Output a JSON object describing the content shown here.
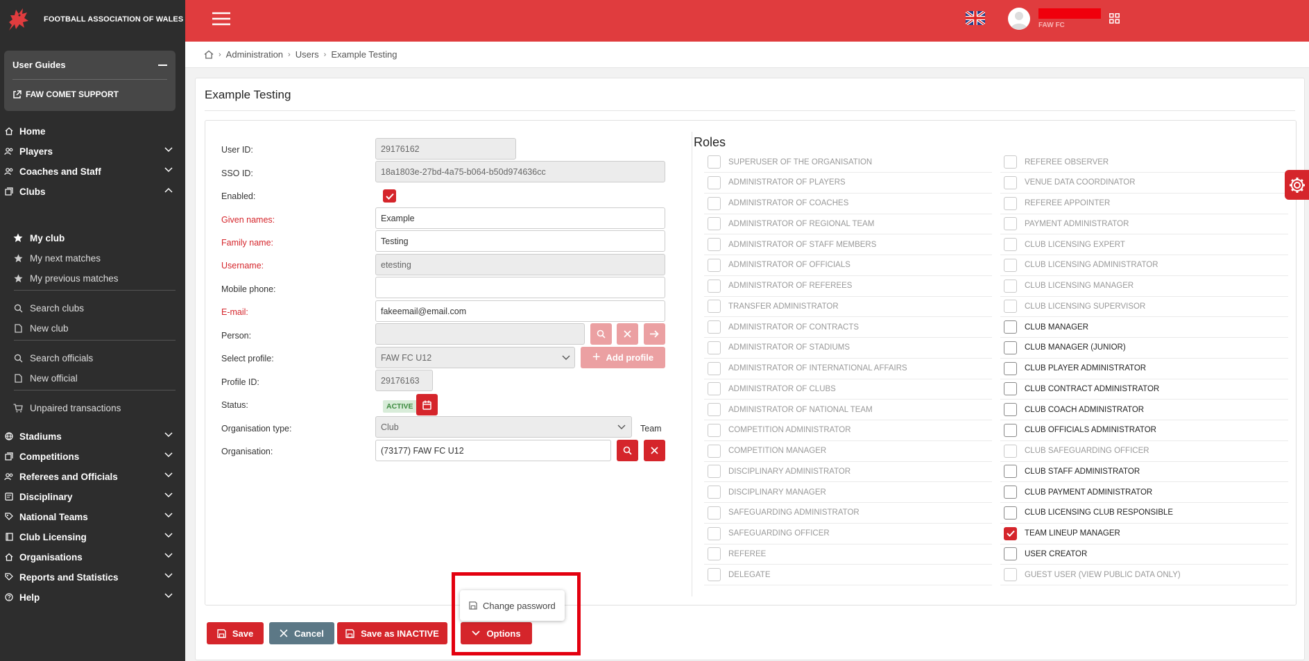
{
  "brand": {
    "name": "FOOTBALL ASSOCIATION OF WALES"
  },
  "sidebar": {
    "guides_title": "User Guides",
    "support_link": "FAW COMET SUPPORT",
    "nav": [
      {
        "label": "Home",
        "icon": "home-icon"
      },
      {
        "label": "Players",
        "icon": "players-icon"
      },
      {
        "label": "Coaches and Staff",
        "icon": "coaches-icon"
      },
      {
        "label": "Clubs",
        "icon": "clubs-icon"
      },
      {
        "label": "Stadiums",
        "icon": "stadium-icon"
      },
      {
        "label": "Competitions",
        "icon": "competitions-icon"
      },
      {
        "label": "Referees and Officials",
        "icon": "referees-icon"
      },
      {
        "label": "Disciplinary",
        "icon": "disciplinary-icon"
      },
      {
        "label": "National Teams",
        "icon": "national-teams-icon"
      },
      {
        "label": "Club Licensing",
        "icon": "club-licensing-icon"
      },
      {
        "label": "Organisations",
        "icon": "organisations-icon"
      },
      {
        "label": "Reports and Statistics",
        "icon": "reports-icon"
      },
      {
        "label": "Help",
        "icon": "help-icon"
      }
    ],
    "clubs_sub": [
      {
        "label": "My club",
        "icon": "star-icon"
      },
      {
        "label": "My next matches",
        "icon": "star-icon"
      },
      {
        "label": "My previous matches",
        "icon": "star-icon"
      },
      {
        "label": "Search clubs",
        "icon": "search-icon"
      },
      {
        "label": "New club",
        "icon": "document-icon"
      },
      {
        "label": "Search officials",
        "icon": "search-icon"
      },
      {
        "label": "New official",
        "icon": "document-icon"
      },
      {
        "label": "Unpaired transactions",
        "icon": "cart-icon"
      }
    ]
  },
  "header": {
    "user_club": "FAW FC"
  },
  "breadcrumb": [
    "Administration",
    "Users",
    "Example Testing"
  ],
  "page": {
    "title": "Example Testing"
  },
  "form": {
    "user_id_label": "User ID:",
    "user_id": "29176162",
    "sso_id_label": "SSO ID:",
    "sso_id": "18a1803e-27bd-4a75-b064-b50d974636cc",
    "enabled_label": "Enabled:",
    "given_names_label": "Given names:",
    "given_names": "Example",
    "family_name_label": "Family name:",
    "family_name": "Testing",
    "username_label": "Username:",
    "username": "etesting",
    "mobile_label": "Mobile phone:",
    "mobile": "",
    "email_label": "E-mail:",
    "email": "fakeemail@email.com",
    "person_label": "Person:",
    "person": "",
    "profile_label": "Select profile:",
    "profile": "FAW FC U12",
    "add_profile": "Add profile",
    "profile_id_label": "Profile ID:",
    "profile_id": "29176163",
    "status_label": "Status:",
    "status": "ACTIVE",
    "org_type_label": "Organisation type:",
    "org_type": "Club",
    "org_type_extra": "Team",
    "org_label": "Organisation:",
    "org": "(73177) FAW FC U12"
  },
  "roles": {
    "title": "Roles",
    "left": [
      {
        "label": "SUPERUSER OF THE ORGANISATION",
        "enabled": false,
        "checked": false
      },
      {
        "label": "ADMINISTRATOR OF PLAYERS",
        "enabled": false,
        "checked": false
      },
      {
        "label": "ADMINISTRATOR OF COACHES",
        "enabled": false,
        "checked": false
      },
      {
        "label": "ADMINISTRATOR OF REGIONAL TEAM",
        "enabled": false,
        "checked": false
      },
      {
        "label": "ADMINISTRATOR OF STAFF MEMBERS",
        "enabled": false,
        "checked": false
      },
      {
        "label": "ADMINISTRATOR OF OFFICIALS",
        "enabled": false,
        "checked": false
      },
      {
        "label": "ADMINISTRATOR OF REFEREES",
        "enabled": false,
        "checked": false
      },
      {
        "label": "TRANSFER ADMINISTRATOR",
        "enabled": false,
        "checked": false
      },
      {
        "label": "ADMINISTRATOR OF CONTRACTS",
        "enabled": false,
        "checked": false
      },
      {
        "label": "ADMINISTRATOR OF STADIUMS",
        "enabled": false,
        "checked": false
      },
      {
        "label": "ADMINISTRATOR OF INTERNATIONAL AFFAIRS",
        "enabled": false,
        "checked": false
      },
      {
        "label": "ADMINISTRATOR OF CLUBS",
        "enabled": false,
        "checked": false
      },
      {
        "label": "ADMINISTRATOR OF NATIONAL TEAM",
        "enabled": false,
        "checked": false
      },
      {
        "label": "COMPETITION ADMINISTRATOR",
        "enabled": false,
        "checked": false
      },
      {
        "label": "COMPETITION MANAGER",
        "enabled": false,
        "checked": false
      },
      {
        "label": "DISCIPLINARY ADMINISTRATOR",
        "enabled": false,
        "checked": false
      },
      {
        "label": "DISCIPLINARY MANAGER",
        "enabled": false,
        "checked": false
      },
      {
        "label": "SAFEGUARDING ADMINISTRATOR",
        "enabled": false,
        "checked": false
      },
      {
        "label": "SAFEGUARDING OFFICER",
        "enabled": false,
        "checked": false
      },
      {
        "label": "REFEREE",
        "enabled": false,
        "checked": false
      },
      {
        "label": "DELEGATE",
        "enabled": false,
        "checked": false
      }
    ],
    "right": [
      {
        "label": "REFEREE OBSERVER",
        "enabled": false,
        "checked": false
      },
      {
        "label": "VENUE DATA COORDINATOR",
        "enabled": false,
        "checked": false
      },
      {
        "label": "REFEREE APPOINTER",
        "enabled": false,
        "checked": false
      },
      {
        "label": "PAYMENT ADMINISTRATOR",
        "enabled": false,
        "checked": false
      },
      {
        "label": "CLUB LICENSING EXPERT",
        "enabled": false,
        "checked": false
      },
      {
        "label": "CLUB LICENSING ADMINISTRATOR",
        "enabled": false,
        "checked": false
      },
      {
        "label": "CLUB LICENSING MANAGER",
        "enabled": false,
        "checked": false
      },
      {
        "label": "CLUB LICENSING SUPERVISOR",
        "enabled": false,
        "checked": false
      },
      {
        "label": "CLUB MANAGER",
        "enabled": true,
        "checked": false
      },
      {
        "label": "CLUB MANAGER (JUNIOR)",
        "enabled": true,
        "checked": false
      },
      {
        "label": "CLUB PLAYER ADMINISTRATOR",
        "enabled": true,
        "checked": false
      },
      {
        "label": "CLUB CONTRACT ADMINISTRATOR",
        "enabled": true,
        "checked": false
      },
      {
        "label": "CLUB COACH ADMINISTRATOR",
        "enabled": true,
        "checked": false
      },
      {
        "label": "CLUB OFFICIALS ADMINISTRATOR",
        "enabled": true,
        "checked": false
      },
      {
        "label": "CLUB SAFEGUARDING OFFICER",
        "enabled": false,
        "checked": false
      },
      {
        "label": "CLUB STAFF ADMINISTRATOR",
        "enabled": true,
        "checked": false
      },
      {
        "label": "CLUB PAYMENT ADMINISTRATOR",
        "enabled": true,
        "checked": false
      },
      {
        "label": "CLUB LICENSING CLUB RESPONSIBLE",
        "enabled": true,
        "checked": false
      },
      {
        "label": "TEAM LINEUP MANAGER",
        "enabled": true,
        "checked": true
      },
      {
        "label": "USER CREATOR",
        "enabled": true,
        "checked": false
      },
      {
        "label": "GUEST USER (VIEW PUBLIC DATA ONLY)",
        "enabled": false,
        "checked": false
      }
    ]
  },
  "actions": {
    "save": "Save",
    "cancel": "Cancel",
    "save_inactive": "Save as INACTIVE",
    "options": "Options"
  },
  "options_menu": {
    "change_password": "Change password"
  },
  "colors": {
    "brand_red": "#e03c3e",
    "button_red": "#d5252b",
    "sidebar": "#2d2d2d",
    "cancel_grey": "#5c7886",
    "highlight": "#e3000f"
  }
}
